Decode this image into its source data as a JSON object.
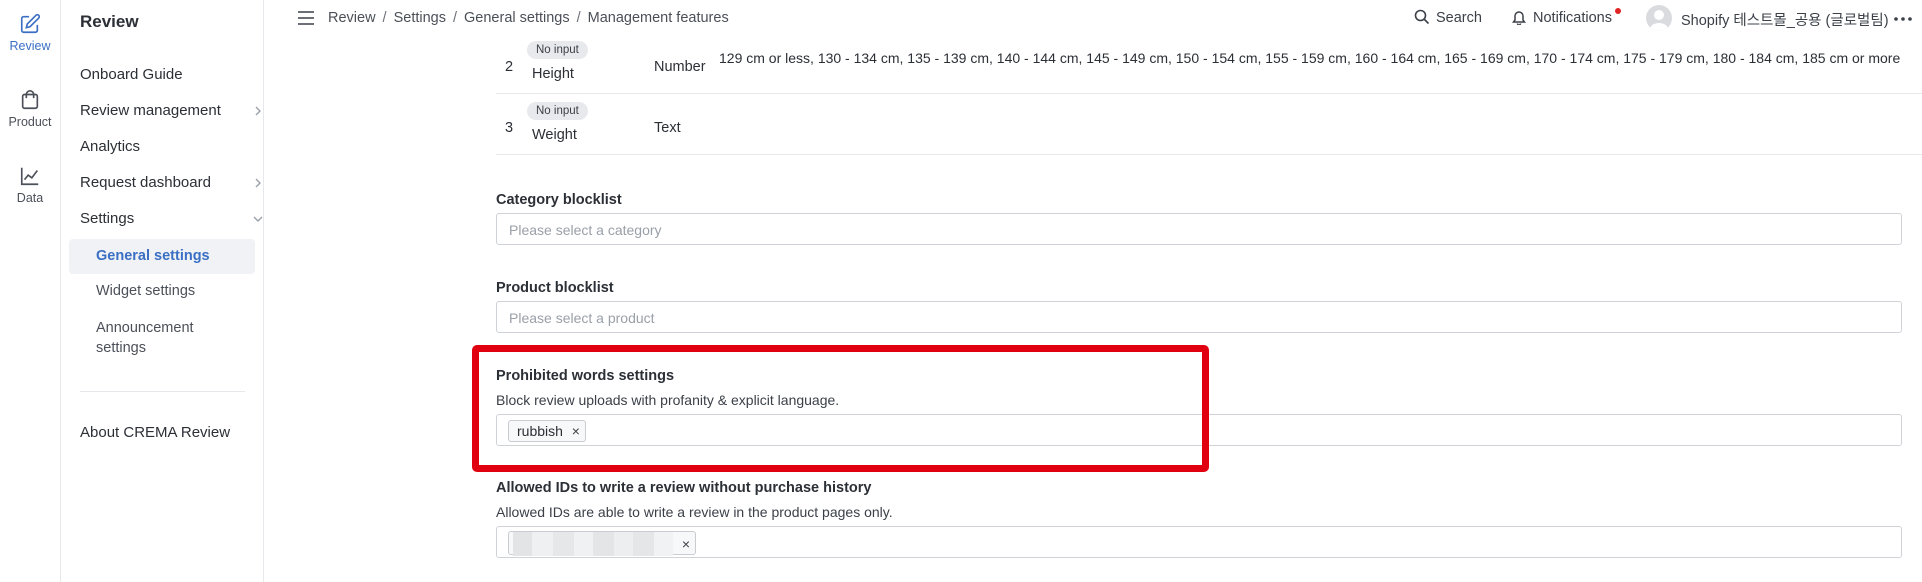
{
  "rail": [
    {
      "label": "Review",
      "icon": "edit-icon",
      "active": true
    },
    {
      "label": "Product",
      "icon": "shopping-bag-icon",
      "active": false
    },
    {
      "label": "Data",
      "icon": "chart-line-icon",
      "active": false
    }
  ],
  "nav": {
    "title": "Review",
    "items": {
      "onboard": "Onboard Guide",
      "review_management": "Review management",
      "analytics": "Analytics",
      "request_dashboard": "Request dashboard",
      "settings": "Settings"
    },
    "sub": {
      "general": "General settings",
      "widget": "Widget settings",
      "announcement": "Announcement settings"
    },
    "about": "About CREMA Review"
  },
  "header": {
    "breadcrumb": [
      "Review",
      "Settings",
      "General settings",
      "Management features"
    ],
    "search": "Search",
    "notifications": "Notifications",
    "store": "Shopify 테스트몰_공용 (글로벌팀)",
    "colors": {
      "notif_dot": "#e02424",
      "accent": "#3b6fc4"
    }
  },
  "table": {
    "rows": [
      {
        "num": "2",
        "badge": "No input",
        "name": "Height",
        "type": "Number",
        "values": "129 cm or less, 130 - 134 cm, 135 - 139 cm, 140 - 144 cm, 145 - 149 cm, 150 - 154 cm, 155 - 159 cm, 160 - 164 cm, 165 - 169 cm, 170 - 174 cm, 175 - 179 cm, 180 - 184 cm, 185 cm or more"
      },
      {
        "num": "3",
        "badge": "No input",
        "name": "Weight",
        "type": "Text",
        "values": ""
      }
    ]
  },
  "category_blocklist": {
    "label": "Category blocklist",
    "placeholder": "Please select a category"
  },
  "product_blocklist": {
    "label": "Product blocklist",
    "placeholder": "Please select a product"
  },
  "prohibited": {
    "label": "Prohibited words settings",
    "desc": "Block review uploads with profanity & explicit language.",
    "tags": [
      "rubbish"
    ],
    "highlight_color": "#e00010"
  },
  "allowed_ids": {
    "label": "Allowed IDs to write a review without purchase history",
    "desc": "Allowed IDs are able to write a review in the product pages only."
  },
  "tag_remove": "×"
}
